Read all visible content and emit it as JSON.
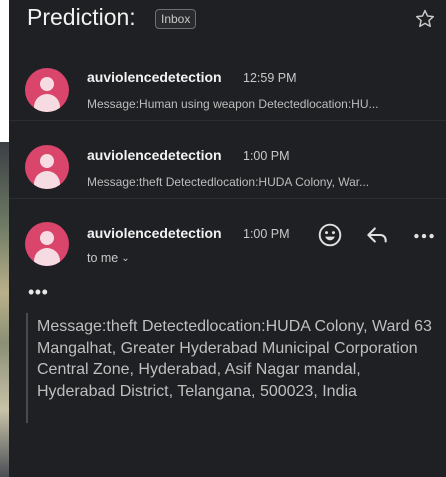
{
  "subject": {
    "title": "Prediction:",
    "label": "Inbox"
  },
  "threads": [
    {
      "sender": "auviolencedetection",
      "time": "12:59 PM",
      "snippet": "Message:Human using weapon Detectedlocation:HU..."
    },
    {
      "sender": "auviolencedetection",
      "time": "1:00 PM",
      "snippet": "Message:theft Detectedlocation:HUDA Colony, War..."
    }
  ],
  "open_message": {
    "sender": "auviolencedetection",
    "time": "1:00 PM",
    "recipient": "to me",
    "more": "•••",
    "body": "Message:theft Detectedlocation:HUDA Colony, Ward 63 Mangalhat, Greater Hyderabad Municipal Corporation Central Zone, Hyderabad, Asif Nagar mandal, Hyderabad District, Telangana, 500023, India"
  },
  "icons": {
    "star": "star-icon",
    "avatar": "person-avatar-icon",
    "emoji": "emoji-icon",
    "reply": "reply-icon",
    "overflow": "more-vert-icon"
  },
  "colors": {
    "avatar": "#d9456b",
    "background": "#1f2023"
  }
}
